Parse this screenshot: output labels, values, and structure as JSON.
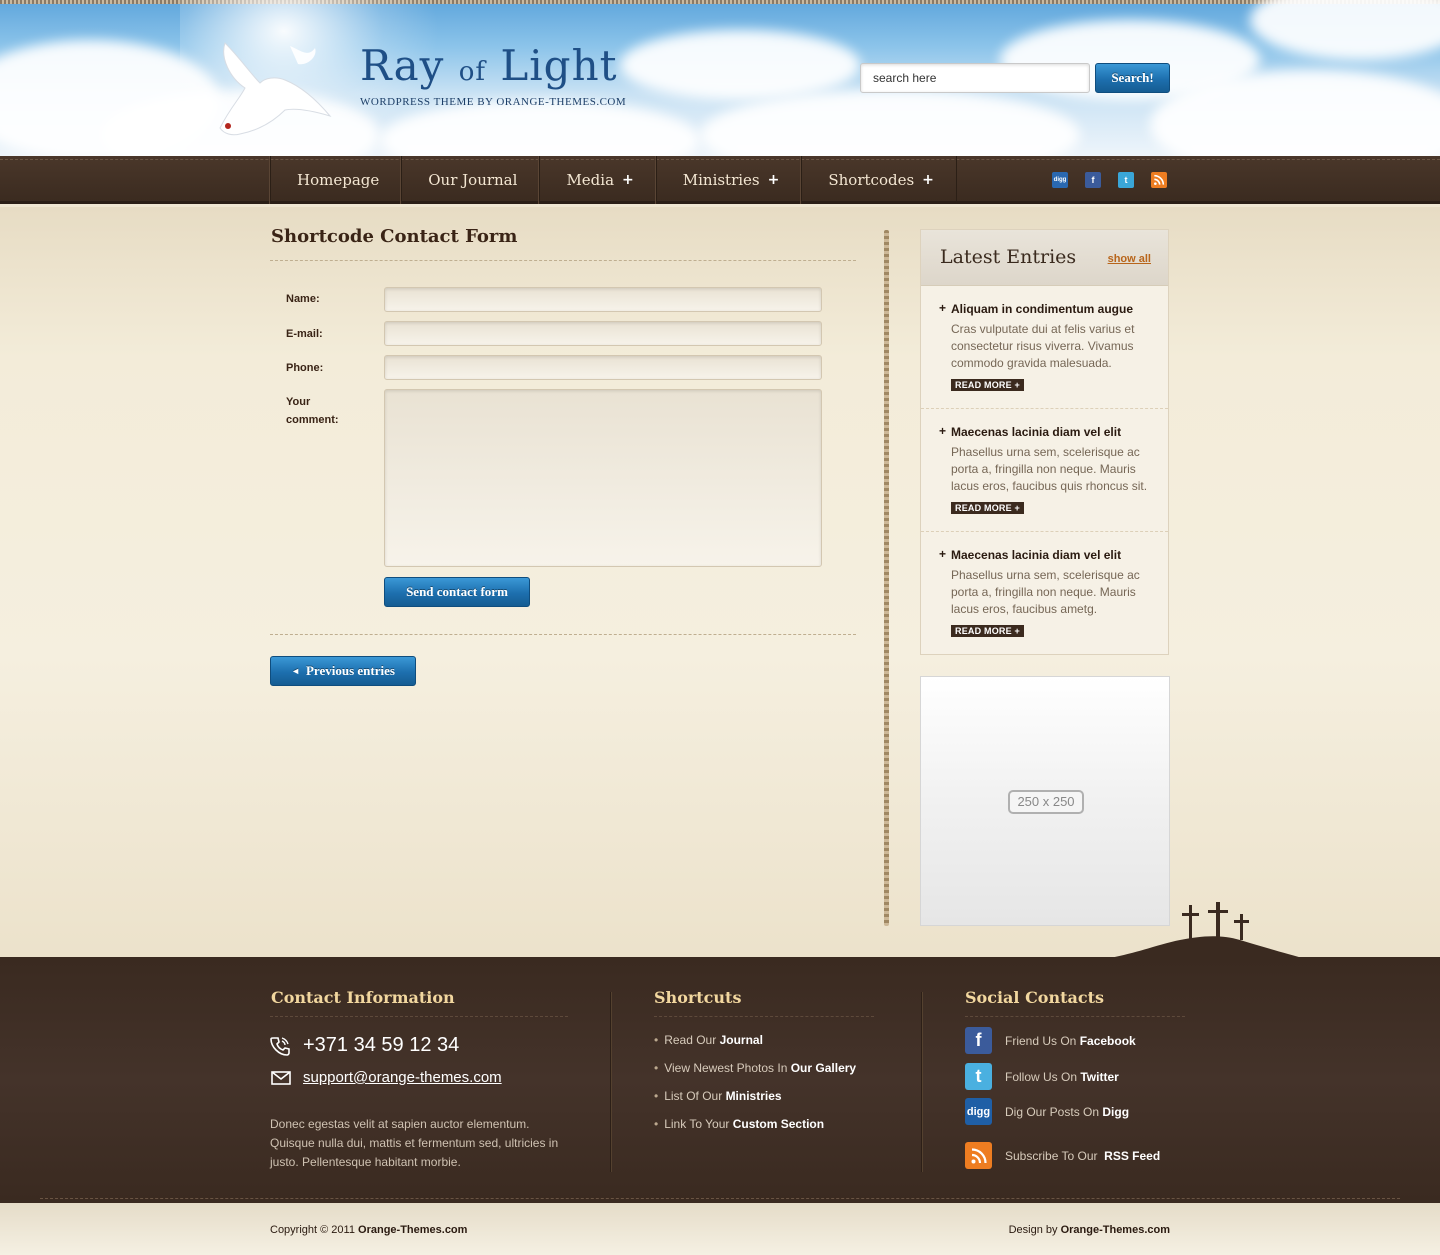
{
  "header": {
    "logo_title_a": "Ray",
    "logo_title_of": "of",
    "logo_title_b": "Light",
    "logo_subtitle": "WORDPRESS THEME BY ORANGE-THEMES.COM",
    "search_value": "search here",
    "search_button": "Search!"
  },
  "nav": {
    "items": [
      {
        "label": "Homepage",
        "has_submenu": false
      },
      {
        "label": "Our Journal",
        "has_submenu": false
      },
      {
        "label": "Media",
        "has_submenu": true
      },
      {
        "label": "Ministries",
        "has_submenu": true
      },
      {
        "label": "Shortcodes",
        "has_submenu": true
      }
    ],
    "social": [
      {
        "name": "digg-icon",
        "label": "digg",
        "color": "#2a68b0"
      },
      {
        "name": "facebook-icon",
        "label": "f",
        "color": "#3b5b9b"
      },
      {
        "name": "twitter-icon",
        "label": "t",
        "color": "#3aa6d8"
      },
      {
        "name": "rss-icon",
        "label": "",
        "color": "#ee7d21"
      }
    ]
  },
  "main": {
    "title": "Shortcode Contact Form",
    "form": {
      "name_label": "Name:",
      "email_label": "E-mail:",
      "phone_label": "Phone:",
      "comment_label_1": "Your",
      "comment_label_2": "comment:",
      "submit_label": "Send contact form"
    },
    "prev_label": "Previous entries"
  },
  "sidebar": {
    "widget_title": "Latest Entries",
    "show_all": "show all",
    "entries": [
      {
        "title": "Aliquam in condimentum augue",
        "text": "Cras vulputate dui at felis varius et consectetur risus viverra. Vivamus commodo gravida malesuada.",
        "read_more": "READ MORE"
      },
      {
        "title": "Maecenas lacinia diam vel elit",
        "text": "Phasellus urna sem, scelerisque ac porta a, fringilla non neque. Mauris lacus eros, faucibus quis rhoncus sit.",
        "read_more": "READ MORE"
      },
      {
        "title": "Maecenas lacinia diam vel elit",
        "text": "Phasellus urna sem, scelerisque ac porta a, fringilla non neque. Mauris lacus eros, faucibus ametg.",
        "read_more": "READ MORE"
      }
    ],
    "ad_label": "250 x 250"
  },
  "footer": {
    "contact": {
      "title": "Contact Information",
      "phone": "+371 34 59 12 34",
      "email": "support@orange-themes.com",
      "description": "Donec egestas velit at sapien auctor elementum. Quisque nulla dui, mattis et fermentum sed, ultricies in justo. Pellentesque habitant morbie."
    },
    "shortcuts": {
      "title": "Shortcuts",
      "items": [
        {
          "text": "Read Our ",
          "bold": "Journal"
        },
        {
          "text": "View Newest Photos In ",
          "bold": "Our Gallery"
        },
        {
          "text": "List Of Our ",
          "bold": "Ministries"
        },
        {
          "text": "Link To Your ",
          "bold": "Custom Section"
        }
      ]
    },
    "social": {
      "title": "Social Contacts",
      "items": [
        {
          "text": "Friend Us On ",
          "bold": "Facebook",
          "icon_label": "f",
          "color": "#3b5b9b"
        },
        {
          "text": "Follow Us On ",
          "bold": "Twitter",
          "icon_label": "t",
          "color": "#4ab0e0"
        },
        {
          "text": "Dig Our Posts On ",
          "bold": "Digg",
          "icon_label": "digg",
          "color": "#1f5fa6"
        },
        {
          "text": "Subscribe To Our  ",
          "bold": "RSS Feed",
          "icon_label": "",
          "color": "#ee7d21"
        }
      ]
    }
  },
  "bottom": {
    "copyright_prefix": "Copyright © 2011 ",
    "copyright_site": "Orange-Themes.com",
    "design_prefix": "Design by ",
    "design_site": "Orange-Themes.com"
  }
}
